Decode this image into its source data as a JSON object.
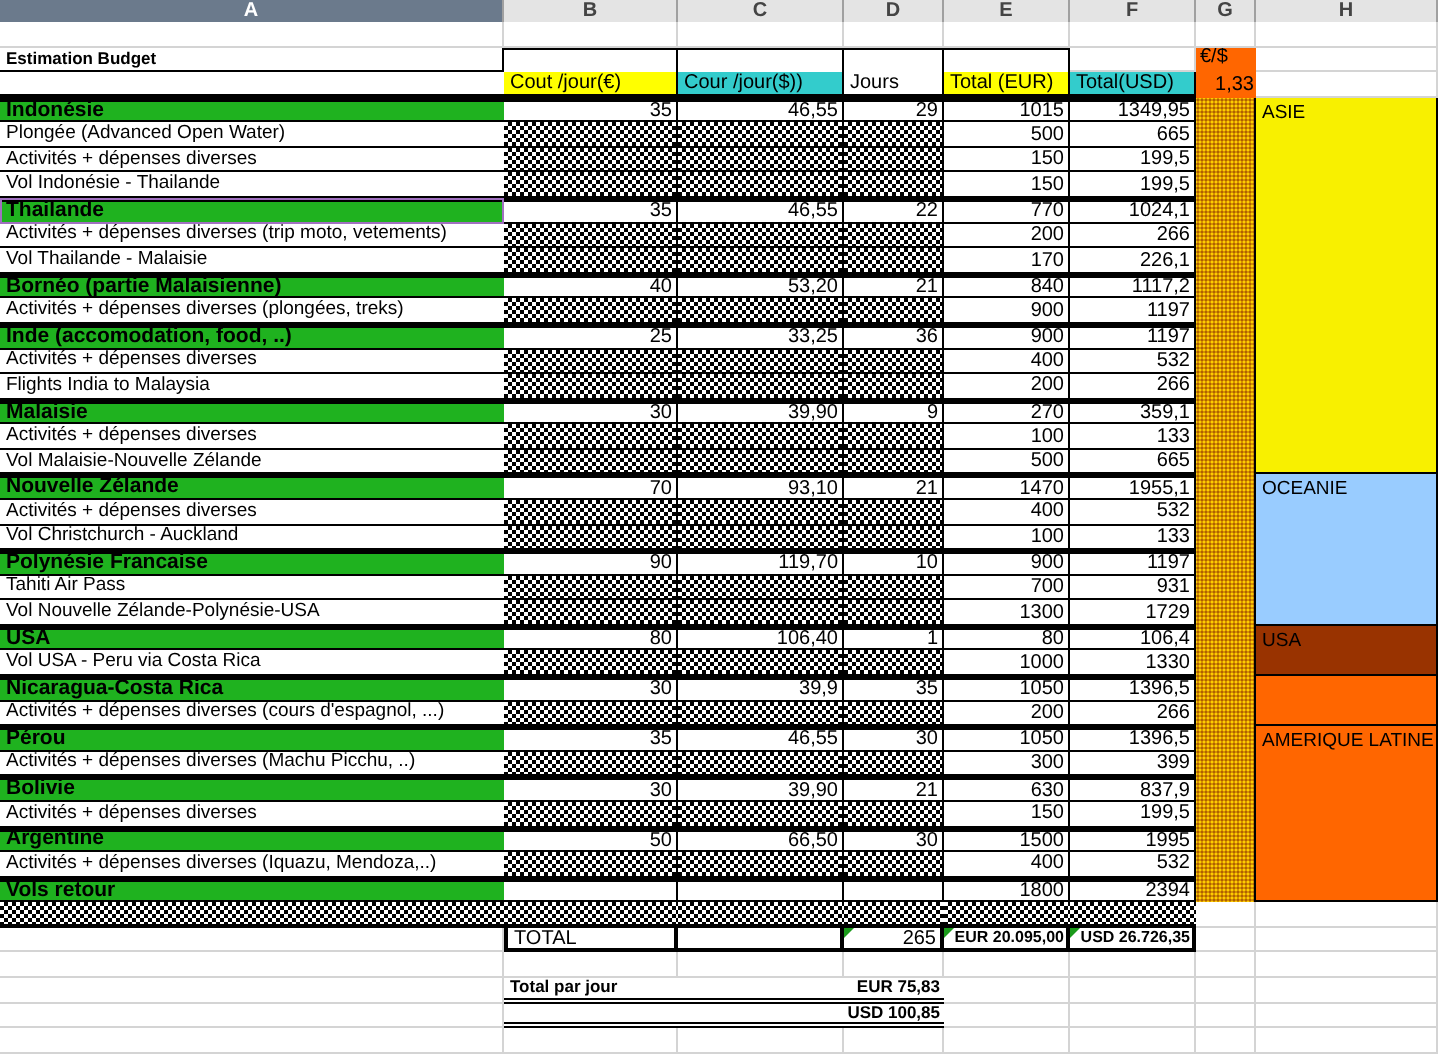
{
  "column_headers": [
    {
      "label": "A",
      "selected": true
    },
    {
      "label": "B",
      "selected": false
    },
    {
      "label": "C",
      "selected": false
    },
    {
      "label": "D",
      "selected": false
    },
    {
      "label": "E",
      "selected": false
    },
    {
      "label": "F",
      "selected": false
    },
    {
      "label": "G",
      "selected": false
    },
    {
      "label": "H",
      "selected": false
    }
  ],
  "title": "Estimation Budget",
  "headers": [
    {
      "text": "Cout /jour(€)",
      "color": "#ffff00"
    },
    {
      "text": "Cour /jour($))",
      "color": "#33cccc"
    },
    {
      "text": "Jours",
      "color": "#ffffff"
    },
    {
      "text": "Total (EUR)",
      "color": "#ffff00"
    },
    {
      "text": "Total(USD)",
      "color": "#33cccc"
    }
  ],
  "rate": {
    "label": "€/$",
    "value": "1,33"
  },
  "regions": [
    {
      "label": "ASIE",
      "color": "#f8f000",
      "countries": [
        {
          "name": "Indonésie",
          "selected": false,
          "cost_eur": "35",
          "cost_usd": "46,55",
          "days": "29",
          "total_eur": "1015",
          "total_usd": "1349,95",
          "items": [
            {
              "label": "Plongée (Advanced Open Water)",
              "total_eur": "500",
              "total_usd": "665"
            },
            {
              "label": "Activités + dépenses diverses",
              "total_eur": "150",
              "total_usd": "199,5"
            },
            {
              "label": "Vol Indonésie - Thailande",
              "total_eur": "150",
              "total_usd": "199,5"
            }
          ]
        },
        {
          "name": "Thailande",
          "selected": true,
          "cost_eur": "35",
          "cost_usd": "46,55",
          "days": "22",
          "total_eur": "770",
          "total_usd": "1024,1",
          "items": [
            {
              "label": "Activités + dépenses diverses (trip moto, vetements)",
              "total_eur": "200",
              "total_usd": "266"
            },
            {
              "label": "Vol Thailande - Malaisie",
              "total_eur": "170",
              "total_usd": "226,1"
            }
          ]
        },
        {
          "name": "Bornéo (partie Malaisienne)",
          "selected": false,
          "cost_eur": "40",
          "cost_usd": "53,20",
          "days": "21",
          "total_eur": "840",
          "total_usd": "1117,2",
          "items": [
            {
              "label": "Activités + dépenses diverses (plongées, treks)",
              "total_eur": "900",
              "total_usd": "1197"
            }
          ]
        },
        {
          "name": "Inde (accomodation, food, ..)",
          "selected": false,
          "cost_eur": "25",
          "cost_usd": "33,25",
          "days": "36",
          "total_eur": "900",
          "total_usd": "1197",
          "items": [
            {
              "label": "Activités + dépenses diverses",
              "total_eur": "400",
              "total_usd": "532"
            },
            {
              "label": "Flights India to Malaysia",
              "total_eur": "200",
              "total_usd": "266"
            }
          ]
        },
        {
          "name": "Malaisie",
          "selected": false,
          "cost_eur": "30",
          "cost_usd": "39,90",
          "days": "9",
          "total_eur": "270",
          "total_usd": "359,1",
          "items": [
            {
              "label": "Activités + dépenses diverses",
              "total_eur": "100",
              "total_usd": "133"
            },
            {
              "label": "Vol Malaisie-Nouvelle Zélande",
              "total_eur": "500",
              "total_usd": "665"
            }
          ]
        }
      ]
    },
    {
      "label": "OCEANIE",
      "color": "#99ccff",
      "countries": [
        {
          "name": "Nouvelle Zélande",
          "selected": false,
          "cost_eur": "70",
          "cost_usd": "93,10",
          "days": "21",
          "total_eur": "1470",
          "total_usd": "1955,1",
          "items": [
            {
              "label": "Activités + dépenses diverses",
              "total_eur": "400",
              "total_usd": "532"
            },
            {
              "label": "Vol Christchurch - Auckland",
              "total_eur": "100",
              "total_usd": "133"
            }
          ]
        },
        {
          "name": "Polynésie Francaise",
          "selected": false,
          "cost_eur": "90",
          "cost_usd": "119,70",
          "days": "10",
          "total_eur": "900",
          "total_usd": "1197",
          "items": [
            {
              "label": "Tahiti Air Pass",
              "total_eur": "700",
              "total_usd": "931"
            },
            {
              "label": "Vol Nouvelle Zélande-Polynésie-USA",
              "total_eur": "1300",
              "total_usd": "1729"
            }
          ]
        }
      ]
    },
    {
      "label": "USA",
      "color": "#993300",
      "countries": [
        {
          "name": "USA",
          "selected": false,
          "cost_eur": "80",
          "cost_usd": "106,40",
          "days": "1",
          "total_eur": "80",
          "total_usd": "106,4",
          "items": [
            {
              "label": "Vol USA - Peru via Costa Rica",
              "total_eur": "1000",
              "total_usd": "1330"
            }
          ]
        }
      ]
    },
    {
      "color": "#ff6600",
      "countries": [
        {
          "name": "Nicaragua-Costa Rica",
          "selected": false,
          "cost_eur": "30",
          "cost_usd": "39,9",
          "days": "35",
          "total_eur": "1050",
          "total_usd": "1396,5",
          "items": [
            {
              "label": "Activités + dépenses diverses (cours d'espagnol, ...)",
              "total_eur": "200",
              "total_usd": "266"
            }
          ]
        }
      ]
    },
    {
      "label": "AMERIQUE LATINE",
      "color": "#ff6600",
      "countries": [
        {
          "name": "Pérou",
          "selected": false,
          "cost_eur": "35",
          "cost_usd": "46,55",
          "days": "30",
          "total_eur": "1050",
          "total_usd": "1396,5",
          "items": [
            {
              "label": "Activités + dépenses diverses (Machu Picchu, ..)",
              "total_eur": "300",
              "total_usd": "399"
            }
          ]
        },
        {
          "name": "Bolivie",
          "selected": false,
          "cost_eur": "30",
          "cost_usd": "39,90",
          "days": "21",
          "total_eur": "630",
          "total_usd": "837,9",
          "items": [
            {
              "label": "Activités + dépenses diverses",
              "total_eur": "150",
              "total_usd": "199,5"
            }
          ]
        },
        {
          "name": "Argentine",
          "selected": false,
          "cost_eur": "50",
          "cost_usd": "66,50",
          "days": "30",
          "total_eur": "1500",
          "total_usd": "1995",
          "items": [
            {
              "label": "Activités + dépenses diverses (Iquazu, Mendoza,..)",
              "total_eur": "400",
              "total_usd": "532"
            }
          ]
        },
        {
          "name": "Vols retour",
          "selected": false,
          "total_eur": "1800",
          "total_usd": "2394"
        }
      ]
    }
  ],
  "totals": {
    "label": "TOTAL",
    "days": {
      "text": "265",
      "flagged": true
    },
    "eur": {
      "text": "EUR 20.095,00",
      "flagged": true
    },
    "usd": {
      "text": "USD 26.726,35",
      "flagged": true
    }
  },
  "per_day": {
    "label": "Total par jour",
    "eur": "EUR 75,83",
    "usd": "USD 100,85"
  }
}
